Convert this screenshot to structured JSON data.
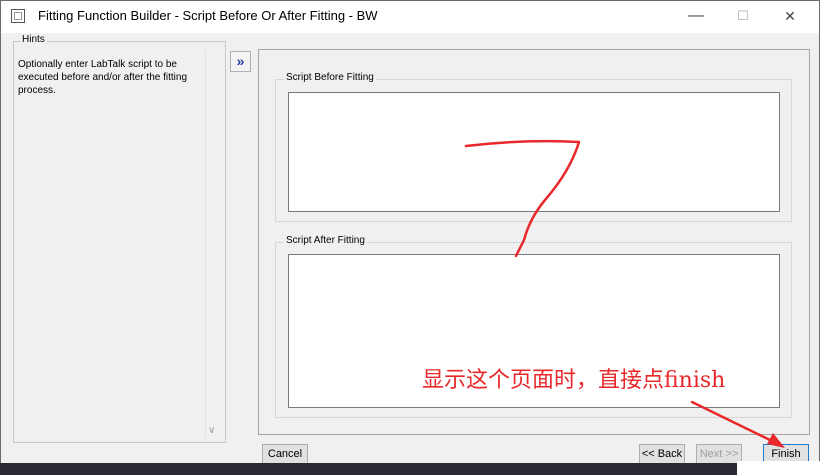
{
  "window": {
    "title": "Fitting Function Builder - Script Before Or After Fitting - BW"
  },
  "titlebar": {
    "minimize": "—",
    "maximize": "☐",
    "close": "✕"
  },
  "hints": {
    "label": "Hints",
    "text": "Optionally enter LabTalk script to be executed before and/or after the fitting process."
  },
  "expand_button": {
    "glyph": "»"
  },
  "script_before": {
    "label": "Script Before Fitting",
    "value": ""
  },
  "script_after": {
    "label": "Script After Fitting",
    "value": ""
  },
  "buttons": {
    "cancel": "Cancel",
    "back": "<< Back",
    "next": "Next >>",
    "finish": "Finish"
  },
  "annotation": {
    "text": "显示这个页面时，直接点finish",
    "color": "#e8282a"
  }
}
